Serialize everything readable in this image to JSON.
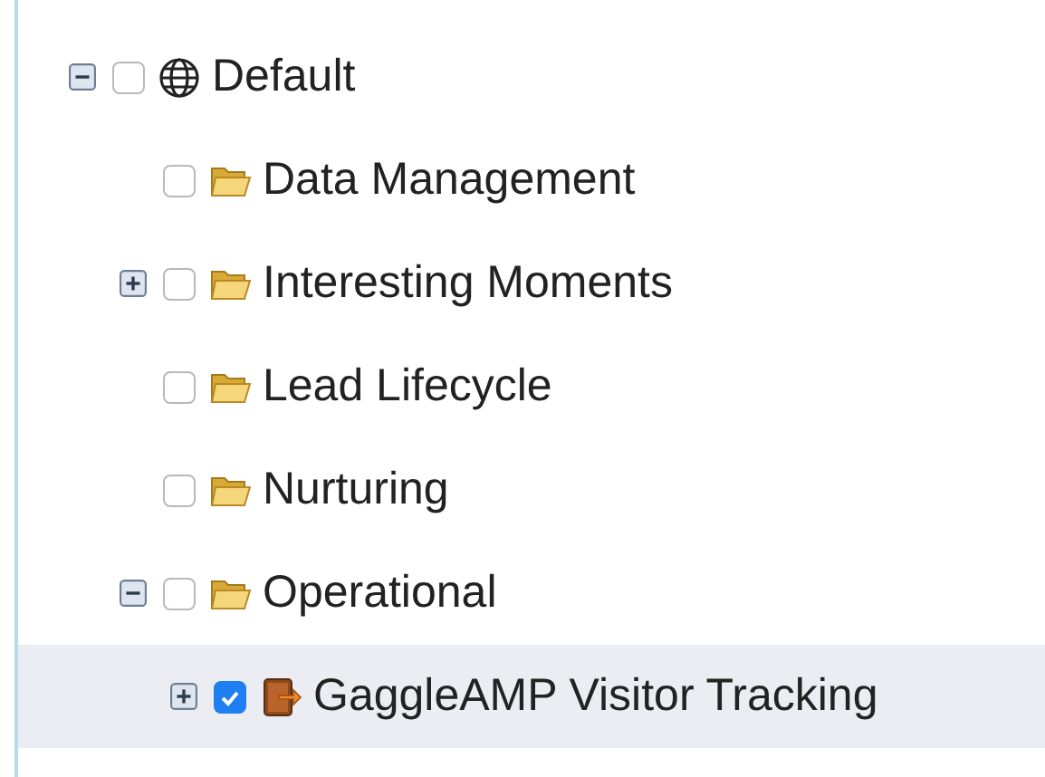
{
  "tree": [
    {
      "label": "Default",
      "kind": "globe",
      "checked": false,
      "selected": false,
      "expanded": true,
      "children": [
        {
          "label": "Data Management",
          "kind": "folder",
          "checked": false,
          "selected": false
        },
        {
          "label": "Interesting Moments",
          "kind": "folder",
          "checked": false,
          "selected": false,
          "expanded": false
        },
        {
          "label": "Lead Lifecycle",
          "kind": "folder",
          "checked": false,
          "selected": false
        },
        {
          "label": "Nurturing",
          "kind": "folder",
          "checked": false,
          "selected": false
        },
        {
          "label": "Operational",
          "kind": "folder",
          "checked": false,
          "selected": false,
          "expanded": true,
          "children": [
            {
              "label": "GaggleAMP Visitor Tracking",
              "kind": "program",
              "checked": true,
              "selected": true,
              "expanded": false
            }
          ]
        }
      ]
    }
  ]
}
